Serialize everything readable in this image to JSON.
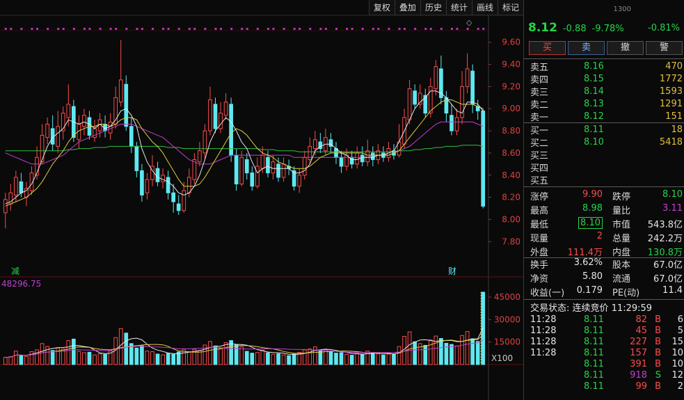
{
  "toolbar": {
    "buttons": [
      "复权",
      "叠加",
      "历史",
      "统计",
      "画线",
      "标记"
    ]
  },
  "markers": {
    "left": "减",
    "right": "财",
    "volume_readout": "48296.75",
    "volume_unit": "X100"
  },
  "colors": {
    "up": "#ff4b4b",
    "down": "#5ee8f0",
    "green": "#27d44a",
    "ma5": "#e8e8e8",
    "ma10": "#e0d040",
    "ma20": "#c040d0",
    "ma60": "#30c040"
  },
  "quote": {
    "price": "8.12",
    "change": "-0.88",
    "change_pct": "-9.78%",
    "index_label": "1300",
    "index_change": "-0.81%"
  },
  "trade_buttons": [
    "买",
    "卖",
    "撤",
    "警"
  ],
  "order_book": {
    "asks": [
      {
        "label": "卖五",
        "price": "8.16",
        "volume": "470"
      },
      {
        "label": "卖四",
        "price": "8.15",
        "volume": "1772"
      },
      {
        "label": "卖三",
        "price": "8.14",
        "volume": "1593"
      },
      {
        "label": "卖二",
        "price": "8.13",
        "volume": "1291"
      },
      {
        "label": "卖一",
        "price": "8.12",
        "volume": "151"
      }
    ],
    "bids": [
      {
        "label": "买一",
        "price": "8.11",
        "volume": "18"
      },
      {
        "label": "买二",
        "price": "8.10",
        "volume": "5418"
      },
      {
        "label": "买三",
        "price": "",
        "volume": ""
      },
      {
        "label": "买四",
        "price": "",
        "volume": ""
      },
      {
        "label": "买五",
        "price": "",
        "volume": ""
      }
    ]
  },
  "stats_a": [
    {
      "l1": "涨停",
      "v1": "9.90",
      "c1": "red",
      "l2": "跌停",
      "v2": "8.10",
      "c2": "green"
    },
    {
      "l1": "最高",
      "v1": "8.98",
      "c1": "green",
      "l2": "量比",
      "v2": "3.11",
      "c2": "purple"
    },
    {
      "l1": "最低",
      "v1": "8.10",
      "c1": "green boxed",
      "l2": "市值",
      "v2": "543.8亿",
      "c2": "white"
    },
    {
      "l1": "现量",
      "v1": "2",
      "c1": "red",
      "l2": "总量",
      "v2": "242.2万",
      "c2": "white"
    },
    {
      "l1": "外盘",
      "v1": "111.4万",
      "c1": "red",
      "l2": "内盘",
      "v2": "130.8万",
      "c2": "green"
    }
  ],
  "stats_b": [
    {
      "l1": "换手",
      "v1": "3.62%",
      "c1": "white",
      "l2": "股本",
      "v2": "67.0亿",
      "c2": "white"
    },
    {
      "l1": "净资",
      "v1": "5.80",
      "c1": "white",
      "l2": "流通",
      "v2": "67.0亿",
      "c2": "white"
    },
    {
      "l1": "收益(一)",
      "v1": "0.179",
      "c1": "white",
      "l2": "PE(动)",
      "v2": "11.4",
      "c2": "white"
    }
  ],
  "status": {
    "label": "交易状态:",
    "value": "连续竞价",
    "time": "11:29:59"
  },
  "ticks": [
    {
      "time": "11:28",
      "price": "8.11",
      "vol": "82",
      "dir": "B",
      "n": "6"
    },
    {
      "time": "11:28",
      "price": "8.11",
      "vol": "45",
      "dir": "B",
      "n": "5"
    },
    {
      "time": "11:28",
      "price": "8.11",
      "vol": "227",
      "dir": "B",
      "n": "15"
    },
    {
      "time": "11:28",
      "price": "8.11",
      "vol": "157",
      "dir": "B",
      "n": "10"
    },
    {
      "time": "",
      "price": "8.11",
      "vol": "391",
      "dir": "B",
      "n": "10"
    },
    {
      "time": "",
      "price": "8.11",
      "vol": "918",
      "dir": "S",
      "n": "12"
    },
    {
      "time": "",
      "price": "8.11",
      "vol": "99",
      "dir": "B",
      "n": "2"
    }
  ],
  "chart_data": {
    "type": "candlestick",
    "price_axis_ticks": [
      "9.60",
      "9.40",
      "9.20",
      "9.00",
      "8.80",
      "8.60",
      "8.40",
      "8.20",
      "8.00",
      "7.80"
    ],
    "volume_axis_ticks": [
      "45000",
      "30000",
      "15000"
    ],
    "price_range": [
      7.72,
      9.68
    ],
    "volume_range": [
      0,
      52000
    ],
    "candles": [
      [
        8.06,
        8.18,
        8.24,
        7.92,
        4800
      ],
      [
        8.14,
        8.24,
        8.32,
        8.08,
        5200
      ],
      [
        8.22,
        8.38,
        8.44,
        8.16,
        9000
      ],
      [
        8.34,
        8.24,
        8.42,
        8.2,
        6200
      ],
      [
        8.2,
        8.28,
        8.34,
        8.12,
        5400
      ],
      [
        8.26,
        8.42,
        8.48,
        8.22,
        8600
      ],
      [
        8.4,
        8.56,
        8.66,
        8.36,
        9800
      ],
      [
        8.52,
        8.76,
        8.86,
        8.5,
        14000
      ],
      [
        8.74,
        8.86,
        8.92,
        8.68,
        12000
      ],
      [
        8.82,
        8.68,
        8.94,
        8.62,
        9400
      ],
      [
        8.66,
        8.84,
        8.98,
        8.6,
        11000
      ],
      [
        8.8,
        8.96,
        9.02,
        8.72,
        10400
      ],
      [
        8.92,
        9.04,
        9.22,
        8.84,
        16000
      ],
      [
        9.02,
        8.74,
        9.08,
        8.7,
        17000
      ],
      [
        8.72,
        8.86,
        8.94,
        8.64,
        8800
      ],
      [
        8.84,
        8.94,
        9.0,
        8.76,
        7900
      ],
      [
        8.92,
        8.76,
        8.98,
        8.72,
        8200
      ],
      [
        8.74,
        8.82,
        8.9,
        8.7,
        6400
      ],
      [
        8.8,
        8.9,
        8.96,
        8.74,
        7200
      ],
      [
        8.86,
        8.8,
        8.94,
        8.74,
        6800
      ],
      [
        8.78,
        8.88,
        8.96,
        8.72,
        9100
      ],
      [
        8.86,
        9.1,
        9.2,
        8.82,
        18000
      ],
      [
        9.06,
        9.26,
        9.62,
        9.02,
        24000
      ],
      [
        9.22,
        8.84,
        9.3,
        8.8,
        21000
      ],
      [
        8.84,
        8.66,
        8.92,
        8.6,
        14000
      ],
      [
        8.66,
        8.44,
        8.7,
        8.38,
        11000
      ],
      [
        8.44,
        8.22,
        8.5,
        8.16,
        12500
      ],
      [
        8.24,
        8.36,
        8.42,
        8.18,
        9000
      ],
      [
        8.36,
        8.48,
        8.58,
        8.3,
        8600
      ],
      [
        8.46,
        8.34,
        8.52,
        8.3,
        7000
      ],
      [
        8.34,
        8.4,
        8.46,
        8.28,
        6500
      ],
      [
        8.38,
        8.24,
        8.44,
        8.18,
        7400
      ],
      [
        8.24,
        8.16,
        8.32,
        8.06,
        6800
      ],
      [
        8.14,
        8.08,
        8.22,
        8.04,
        8400
      ],
      [
        8.08,
        8.26,
        8.34,
        8.06,
        9800
      ],
      [
        8.24,
        8.38,
        8.46,
        8.2,
        8600
      ],
      [
        8.36,
        8.54,
        8.6,
        8.32,
        10200
      ],
      [
        8.52,
        8.62,
        8.7,
        8.48,
        9400
      ],
      [
        8.6,
        8.8,
        8.86,
        8.54,
        13000
      ],
      [
        8.8,
        9.08,
        9.2,
        8.76,
        15400
      ],
      [
        9.04,
        8.82,
        9.1,
        8.78,
        12400
      ],
      [
        8.82,
        8.96,
        9.06,
        8.78,
        11000
      ],
      [
        8.94,
        9.06,
        9.14,
        8.9,
        14600
      ],
      [
        9.04,
        8.58,
        9.1,
        8.52,
        16000
      ],
      [
        8.58,
        8.32,
        8.64,
        8.26,
        13400
      ],
      [
        8.32,
        8.56,
        8.62,
        8.3,
        11800
      ],
      [
        8.54,
        8.42,
        8.6,
        8.36,
        8800
      ],
      [
        8.42,
        8.3,
        8.48,
        8.26,
        7600
      ],
      [
        8.3,
        8.48,
        8.56,
        8.28,
        8000
      ],
      [
        8.46,
        8.58,
        8.66,
        8.42,
        9600
      ],
      [
        8.56,
        8.42,
        8.62,
        8.38,
        7800
      ],
      [
        8.42,
        8.52,
        8.58,
        8.36,
        6900
      ],
      [
        8.5,
        8.38,
        8.56,
        8.34,
        7200
      ],
      [
        8.38,
        8.5,
        8.56,
        8.34,
        6400
      ],
      [
        8.48,
        8.46,
        8.54,
        8.4,
        5900
      ],
      [
        8.44,
        8.3,
        8.48,
        8.26,
        7000
      ],
      [
        8.3,
        8.4,
        8.46,
        8.24,
        8100
      ],
      [
        8.4,
        8.56,
        8.62,
        8.36,
        9800
      ],
      [
        8.54,
        8.66,
        8.74,
        8.5,
        10400
      ],
      [
        8.64,
        8.72,
        8.8,
        8.58,
        11800
      ],
      [
        8.7,
        8.64,
        8.78,
        8.6,
        9200
      ],
      [
        8.62,
        8.74,
        8.82,
        8.58,
        10000
      ],
      [
        8.72,
        8.66,
        8.78,
        8.6,
        8400
      ],
      [
        8.64,
        8.56,
        8.7,
        8.5,
        7600
      ],
      [
        8.56,
        8.48,
        8.62,
        8.42,
        7900
      ],
      [
        8.48,
        8.58,
        8.64,
        8.44,
        6800
      ],
      [
        8.56,
        8.5,
        8.62,
        8.46,
        6200
      ],
      [
        8.5,
        8.6,
        8.66,
        8.46,
        7400
      ],
      [
        8.58,
        8.52,
        8.66,
        8.48,
        6600
      ],
      [
        8.52,
        8.62,
        8.72,
        8.48,
        9000
      ],
      [
        8.6,
        8.54,
        8.66,
        8.48,
        8000
      ],
      [
        8.54,
        8.62,
        8.68,
        8.5,
        7200
      ],
      [
        8.6,
        8.56,
        8.66,
        8.52,
        6400
      ],
      [
        8.56,
        8.64,
        8.7,
        8.52,
        7000
      ],
      [
        8.62,
        8.58,
        8.68,
        8.54,
        6800
      ],
      [
        8.58,
        8.7,
        8.86,
        8.56,
        12000
      ],
      [
        8.68,
        8.92,
        9.0,
        8.64,
        18800
      ],
      [
        8.9,
        9.18,
        9.26,
        8.86,
        21800
      ],
      [
        9.16,
        9.04,
        9.22,
        9.0,
        15200
      ],
      [
        9.04,
        9.14,
        9.22,
        9.0,
        14000
      ],
      [
        9.12,
        8.96,
        9.18,
        8.92,
        12800
      ],
      [
        8.96,
        9.2,
        9.28,
        8.92,
        16400
      ],
      [
        9.18,
        9.38,
        9.44,
        9.12,
        19000
      ],
      [
        9.36,
        9.1,
        9.48,
        9.04,
        17400
      ],
      [
        9.1,
        8.96,
        9.16,
        8.88,
        14200
      ],
      [
        8.94,
        8.8,
        9.04,
        8.76,
        13400
      ],
      [
        8.8,
        8.92,
        9.0,
        8.76,
        12400
      ],
      [
        8.92,
        9.2,
        9.34,
        8.86,
        19400
      ],
      [
        9.2,
        9.36,
        9.5,
        9.14,
        22000
      ],
      [
        9.34,
        9.04,
        9.4,
        8.96,
        17200
      ],
      [
        9.02,
        8.98,
        9.08,
        8.9,
        15400
      ],
      [
        8.98,
        8.12,
        9.0,
        8.1,
        48296
      ]
    ],
    "ma5": [
      8.14,
      8.16,
      8.2,
      8.24,
      8.26,
      8.32,
      8.42,
      8.54,
      8.66,
      8.74,
      8.78,
      8.82,
      8.9,
      8.88,
      8.86,
      8.88,
      8.86,
      8.82,
      8.86,
      8.82,
      8.84,
      8.9,
      8.98,
      9.0,
      8.94,
      8.84,
      8.64,
      8.52,
      8.44,
      8.38,
      8.36,
      8.34,
      8.3,
      8.24,
      8.22,
      8.24,
      8.3,
      8.4,
      8.54,
      8.7,
      8.8,
      8.86,
      8.92,
      8.88,
      8.8,
      8.7,
      8.64,
      8.52,
      8.42,
      8.46,
      8.48,
      8.46,
      8.46,
      8.46,
      8.46,
      8.42,
      8.42,
      8.44,
      8.5,
      8.62,
      8.66,
      8.68,
      8.68,
      8.64,
      8.6,
      8.58,
      8.54,
      8.54,
      8.56,
      8.56,
      8.56,
      8.58,
      8.58,
      8.6,
      8.62,
      8.7,
      8.8,
      8.9,
      9.0,
      9.06,
      9.1,
      9.16,
      9.16,
      9.14,
      9.1,
      9.04,
      8.98,
      8.96,
      9.06,
      9.06,
      9.04,
      8.98
    ],
    "ma10": [
      8.12,
      8.14,
      8.16,
      8.18,
      8.2,
      8.24,
      8.28,
      8.34,
      8.42,
      8.5,
      8.56,
      8.62,
      8.7,
      8.76,
      8.8,
      8.82,
      8.84,
      8.84,
      8.86,
      8.86,
      8.84,
      8.86,
      8.9,
      8.92,
      8.92,
      8.9,
      8.82,
      8.76,
      8.7,
      8.66,
      8.6,
      8.52,
      8.44,
      8.36,
      8.3,
      8.3,
      8.3,
      8.32,
      8.38,
      8.46,
      8.54,
      8.62,
      8.7,
      8.78,
      8.82,
      8.8,
      8.76,
      8.7,
      8.64,
      8.6,
      8.58,
      8.56,
      8.52,
      8.5,
      8.48,
      8.46,
      8.46,
      8.46,
      8.48,
      8.52,
      8.56,
      8.58,
      8.6,
      8.6,
      8.6,
      8.6,
      8.6,
      8.6,
      8.6,
      8.58,
      8.58,
      8.58,
      8.58,
      8.58,
      8.6,
      8.62,
      8.68,
      8.74,
      8.8,
      8.86,
      8.92,
      8.98,
      9.02,
      9.06,
      9.08,
      9.08,
      9.06,
      9.04,
      9.04,
      9.04,
      9.02,
      9.0
    ],
    "ma20": [
      8.6,
      8.58,
      8.56,
      8.54,
      8.52,
      8.5,
      8.5,
      8.5,
      8.52,
      8.54,
      8.56,
      8.58,
      8.62,
      8.66,
      8.7,
      8.72,
      8.74,
      8.76,
      8.78,
      8.8,
      8.82,
      8.84,
      8.86,
      8.86,
      8.86,
      8.84,
      8.82,
      8.8,
      8.78,
      8.76,
      8.74,
      8.7,
      8.66,
      8.62,
      8.58,
      8.54,
      8.52,
      8.5,
      8.5,
      8.5,
      8.52,
      8.54,
      8.56,
      8.58,
      8.58,
      8.58,
      8.58,
      8.58,
      8.58,
      8.58,
      8.58,
      8.58,
      8.58,
      8.58,
      8.58,
      8.56,
      8.56,
      8.56,
      8.56,
      8.56,
      8.56,
      8.56,
      8.56,
      8.56,
      8.56,
      8.56,
      8.56,
      8.56,
      8.56,
      8.56,
      8.58,
      8.58,
      8.58,
      8.58,
      8.6,
      8.62,
      8.64,
      8.66,
      8.7,
      8.74,
      8.78,
      8.82,
      8.86,
      8.88,
      8.88,
      8.88,
      8.88,
      8.88,
      8.88,
      8.88,
      8.86,
      8.84
    ],
    "ma60": [
      8.62,
      8.62,
      8.62,
      8.62,
      8.62,
      8.62,
      8.62,
      8.62,
      8.62,
      8.62,
      8.62,
      8.62,
      8.63,
      8.63,
      8.64,
      8.64,
      8.64,
      8.65,
      8.65,
      8.65,
      8.66,
      8.66,
      8.66,
      8.66,
      8.66,
      8.66,
      8.66,
      8.66,
      8.66,
      8.66,
      8.66,
      8.65,
      8.65,
      8.65,
      8.64,
      8.64,
      8.64,
      8.64,
      8.64,
      8.64,
      8.64,
      8.64,
      8.64,
      8.64,
      8.64,
      8.64,
      8.64,
      8.64,
      8.64,
      8.63,
      8.63,
      8.63,
      8.62,
      8.62,
      8.62,
      8.62,
      8.61,
      8.61,
      8.61,
      8.61,
      8.61,
      8.61,
      8.61,
      8.61,
      8.61,
      8.61,
      8.61,
      8.61,
      8.61,
      8.61,
      8.61,
      8.61,
      8.61,
      8.61,
      8.61,
      8.62,
      8.62,
      8.62,
      8.63,
      8.63,
      8.64,
      8.64,
      8.65,
      8.65,
      8.66,
      8.66,
      8.66,
      8.67,
      8.67,
      8.67,
      8.67,
      8.66
    ]
  }
}
